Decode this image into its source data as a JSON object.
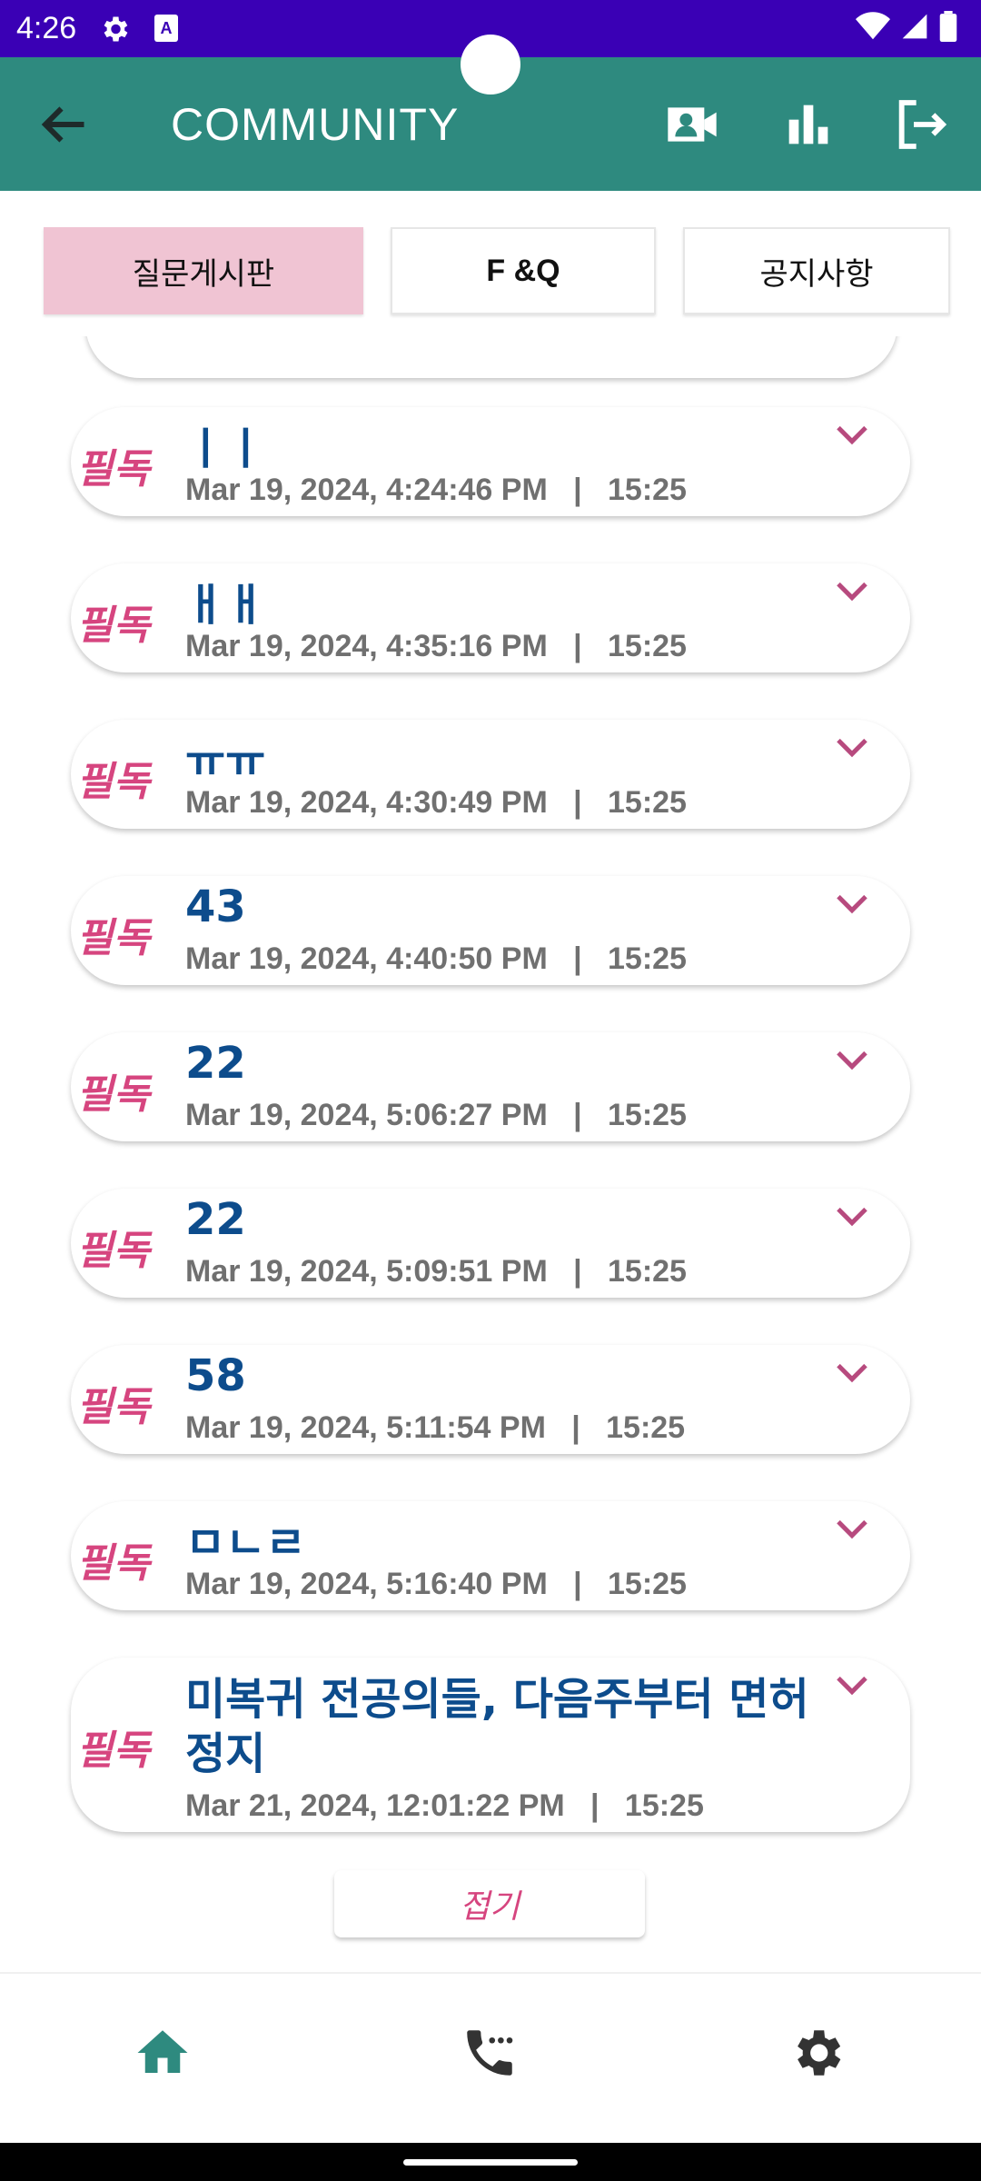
{
  "status_bar": {
    "time": "4:26",
    "a_badge": "A"
  },
  "app_bar": {
    "title": "COMMUNITY"
  },
  "tabs": [
    {
      "label": "질문게시판",
      "active": true
    },
    {
      "label": "F &Q",
      "active": false
    },
    {
      "label": "공지사항",
      "active": false
    }
  ],
  "posts": [
    {
      "tag": "필독",
      "title": "ㅣㅣ",
      "date": "Mar 19, 2024, 4:24:46 PM",
      "sep": "|",
      "count": "15:25"
    },
    {
      "tag": "필독",
      "title": "ㅐㅐ",
      "date": "Mar 19, 2024, 4:35:16 PM",
      "sep": "|",
      "count": "15:25"
    },
    {
      "tag": "필독",
      "title": "ㅠㅠ",
      "date": "Mar 19, 2024, 4:30:49 PM",
      "sep": "|",
      "count": "15:25"
    },
    {
      "tag": "필독",
      "title": "43",
      "date": "Mar 19, 2024, 4:40:50 PM",
      "sep": "|",
      "count": "15:25"
    },
    {
      "tag": "필독",
      "title": "22",
      "date": "Mar 19, 2024, 5:06:27 PM",
      "sep": "|",
      "count": "15:25"
    },
    {
      "tag": "필독",
      "title": "22",
      "date": "Mar 19, 2024, 5:09:51 PM",
      "sep": "|",
      "count": "15:25"
    },
    {
      "tag": "필독",
      "title": "58",
      "date": "Mar 19, 2024, 5:11:54 PM",
      "sep": "|",
      "count": "15:25"
    },
    {
      "tag": "필독",
      "title": "ㅁㄴㄹ",
      "date": "Mar 19, 2024, 5:16:40 PM",
      "sep": "|",
      "count": "15:25"
    },
    {
      "tag": "필독",
      "title": "미복귀 전공의들, 다음주부터 면허",
      "title_line2": "정지",
      "date": "Mar 21, 2024, 12:01:22 PM",
      "sep": "|",
      "count": "15:25"
    }
  ],
  "collapse_label": "접기",
  "colors": {
    "status_bar": "#3a00b5",
    "app_bar": "#2e8a7f",
    "tab_active": "#f0c4d3",
    "tag": "#d6457f",
    "title": "#0d4c8c",
    "meta": "#707070"
  },
  "icons": {
    "app_bar": [
      "back-arrow-icon",
      "video-contact-icon",
      "bar-chart-icon",
      "logout-icon"
    ],
    "bottom_nav": [
      "home-icon",
      "phone-icon",
      "settings-icon"
    ]
  }
}
